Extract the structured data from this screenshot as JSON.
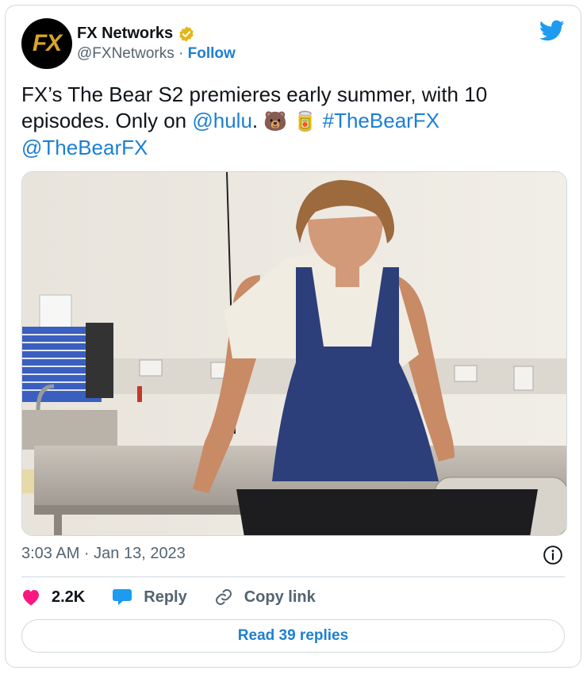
{
  "account": {
    "avatar_text": "FX",
    "display_name": "FX Networks",
    "handle": "@FXNetworks",
    "separator": "·",
    "follow_label": "Follow"
  },
  "tweet": {
    "text_part1": "FX’s The Bear S2 premieres early summer, with 10 episodes. Only on ",
    "mention_hulu": "@hulu",
    "text_part2": ". ",
    "emoji_bear": "🐻",
    "emoji_can": "🥫",
    "hashtag": "#TheBearFX",
    "mention_show": "@TheBearFX"
  },
  "meta": {
    "timestamp": "3:03 AM · Jan 13, 2023"
  },
  "actions": {
    "like_count": "2.2K",
    "reply_label": "Reply",
    "copy_label": "Copy link"
  },
  "footer": {
    "read_replies_label": "Read 39 replies"
  },
  "icons": {
    "verified": "verified-badge-icon",
    "twitter": "twitter-bird-icon",
    "info": "info-icon",
    "like": "heart-icon",
    "reply": "speech-bubble-icon",
    "copy": "link-icon"
  },
  "colors": {
    "link": "#1d7fd4",
    "like": "#f91880",
    "twitter_blue": "#1d9bf0",
    "verified_gold": "#e2b719"
  }
}
